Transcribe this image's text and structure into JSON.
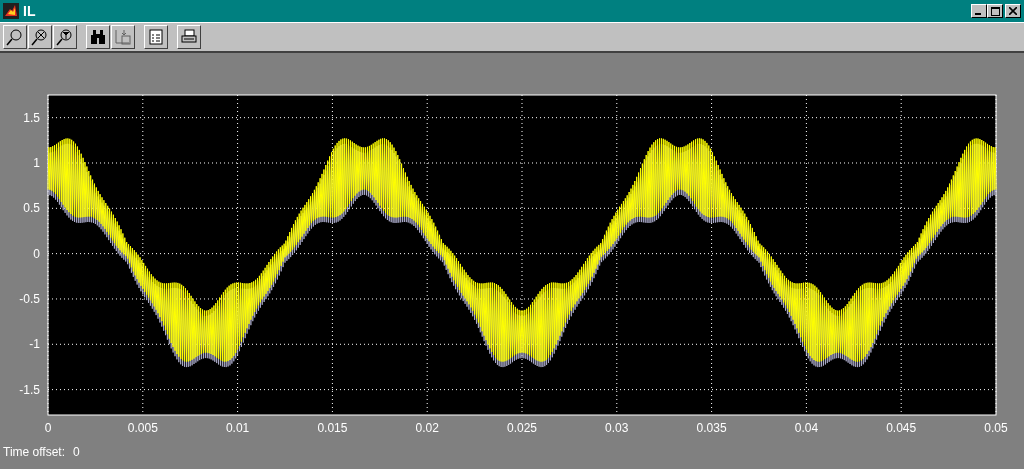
{
  "window": {
    "title": "IL"
  },
  "plot": {
    "yticks": [
      "1.5",
      "1",
      "0.5",
      "0",
      "-0.5",
      "-1",
      "-1.5"
    ],
    "xticks": [
      "0",
      "0.005",
      "0.01",
      "0.015",
      "0.02",
      "0.025",
      "0.03",
      "0.035",
      "0.04",
      "0.045",
      "0.05"
    ]
  },
  "status": {
    "label": "Time offset:",
    "value": "0"
  }
}
